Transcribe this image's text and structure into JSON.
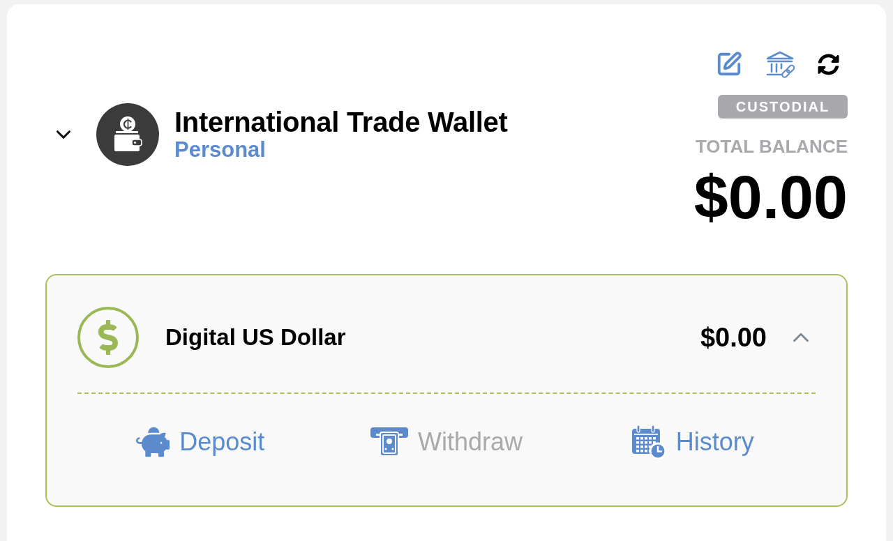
{
  "wallet": {
    "name": "International Trade Wallet",
    "type": "Personal",
    "custody_badge": "CUSTODIAL",
    "balance_label": "TOTAL BALANCE",
    "balance": "$0.00"
  },
  "assets": [
    {
      "name": "Digital US Dollar",
      "balance": "$0.00",
      "expanded": true,
      "actions": [
        {
          "kind": "deposit",
          "label": "Deposit",
          "disabled": false
        },
        {
          "kind": "withdraw",
          "label": "Withdraw",
          "disabled": true
        },
        {
          "kind": "history",
          "label": "History",
          "disabled": false
        }
      ]
    }
  ]
}
